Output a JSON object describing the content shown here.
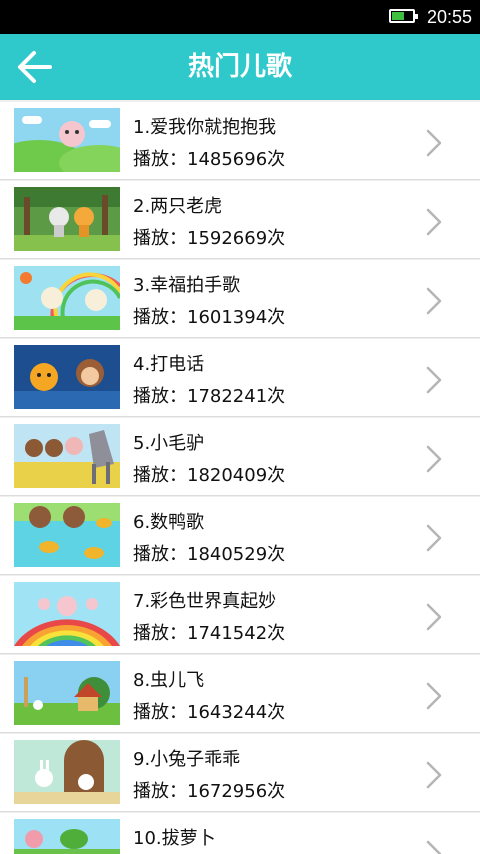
{
  "status": {
    "time": "20:55",
    "battery": 0.6
  },
  "header": {
    "title": "热门儿歌",
    "back_icon": "arrow-left-icon"
  },
  "colors": {
    "appbar": "#2fc9cb",
    "chevron": "#b5b5b5"
  },
  "songs": [
    {
      "name": "1.爱我你就抱抱我",
      "plays": "播放：1485696次",
      "scene": "green-meadow"
    },
    {
      "name": "2.两只老虎",
      "plays": "播放：1592669次",
      "scene": "forest"
    },
    {
      "name": "3.幸福拍手歌",
      "plays": "播放：1601394次",
      "scene": "rainbow-field"
    },
    {
      "name": "4.打电话",
      "plays": "播放：1782241次",
      "scene": "night-blue"
    },
    {
      "name": "5.小毛驴",
      "plays": "播放：1820409次",
      "scene": "yellow-field"
    },
    {
      "name": "6.数鸭歌",
      "plays": "播放：1840529次",
      "scene": "pond"
    },
    {
      "name": "7.彩色世界真起妙",
      "plays": "播放：1741542次",
      "scene": "rainbow"
    },
    {
      "name": "8.虫儿飞",
      "plays": "播放：1643244次",
      "scene": "village"
    },
    {
      "name": "9.小兔子乖乖",
      "plays": "播放：1672956次",
      "scene": "door"
    },
    {
      "name": "10.拔萝卜",
      "plays": "",
      "scene": "garden"
    }
  ]
}
